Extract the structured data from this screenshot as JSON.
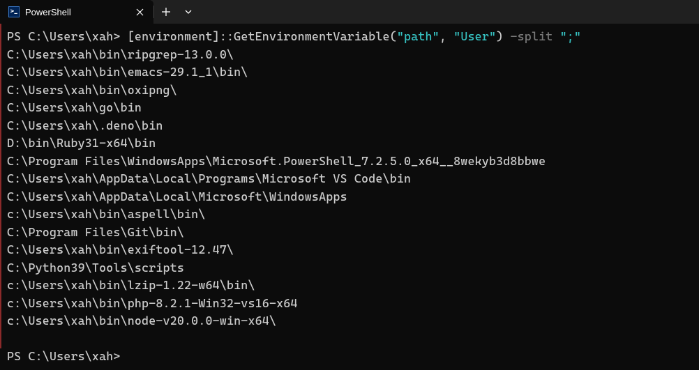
{
  "tab": {
    "title": "PowerShell",
    "icon_glyph": ">_"
  },
  "command": {
    "prompt1": "PS C:\\Users\\xah> ",
    "part_env": "[environment]",
    "part_method": "::GetEnvironmentVariable(",
    "arg1": "\"path\"",
    "comma": ", ",
    "arg2": "\"User\"",
    "close_paren": ") ",
    "param": "-split",
    "space": " ",
    "arg3": "\";\""
  },
  "output_lines": [
    "C:\\Users\\xah\\bin\\ripgrep-13.0.0\\",
    "C:\\Users\\xah\\bin\\emacs-29.1_1\\bin\\",
    "C:\\Users\\xah\\bin\\oxipng\\",
    "C:\\Users\\xah\\go\\bin",
    "C:\\Users\\xah\\.deno\\bin",
    "D:\\bin\\Ruby31-x64\\bin",
    "C:\\Program Files\\WindowsApps\\Microsoft.PowerShell_7.2.5.0_x64__8wekyb3d8bbwe",
    "C:\\Users\\xah\\AppData\\Local\\Programs\\Microsoft VS Code\\bin",
    "C:\\Users\\xah\\AppData\\Local\\Microsoft\\WindowsApps",
    "c:\\Users\\xah\\bin\\aspell\\bin\\",
    "C:\\Program Files\\Git\\bin\\",
    "C:\\Users\\xah\\bin\\exiftool-12.47\\",
    "C:\\Python39\\Tools\\scripts",
    "c:\\Users\\xah\\bin\\lzip-1.22-w64\\bin\\",
    "c:\\Users\\xah\\bin\\php-8.2.1-Win32-vs16-x64",
    "c:\\Users\\xah\\bin\\node-v20.0.0-win-x64\\"
  ],
  "prompt2": "PS C:\\Users\\xah>"
}
